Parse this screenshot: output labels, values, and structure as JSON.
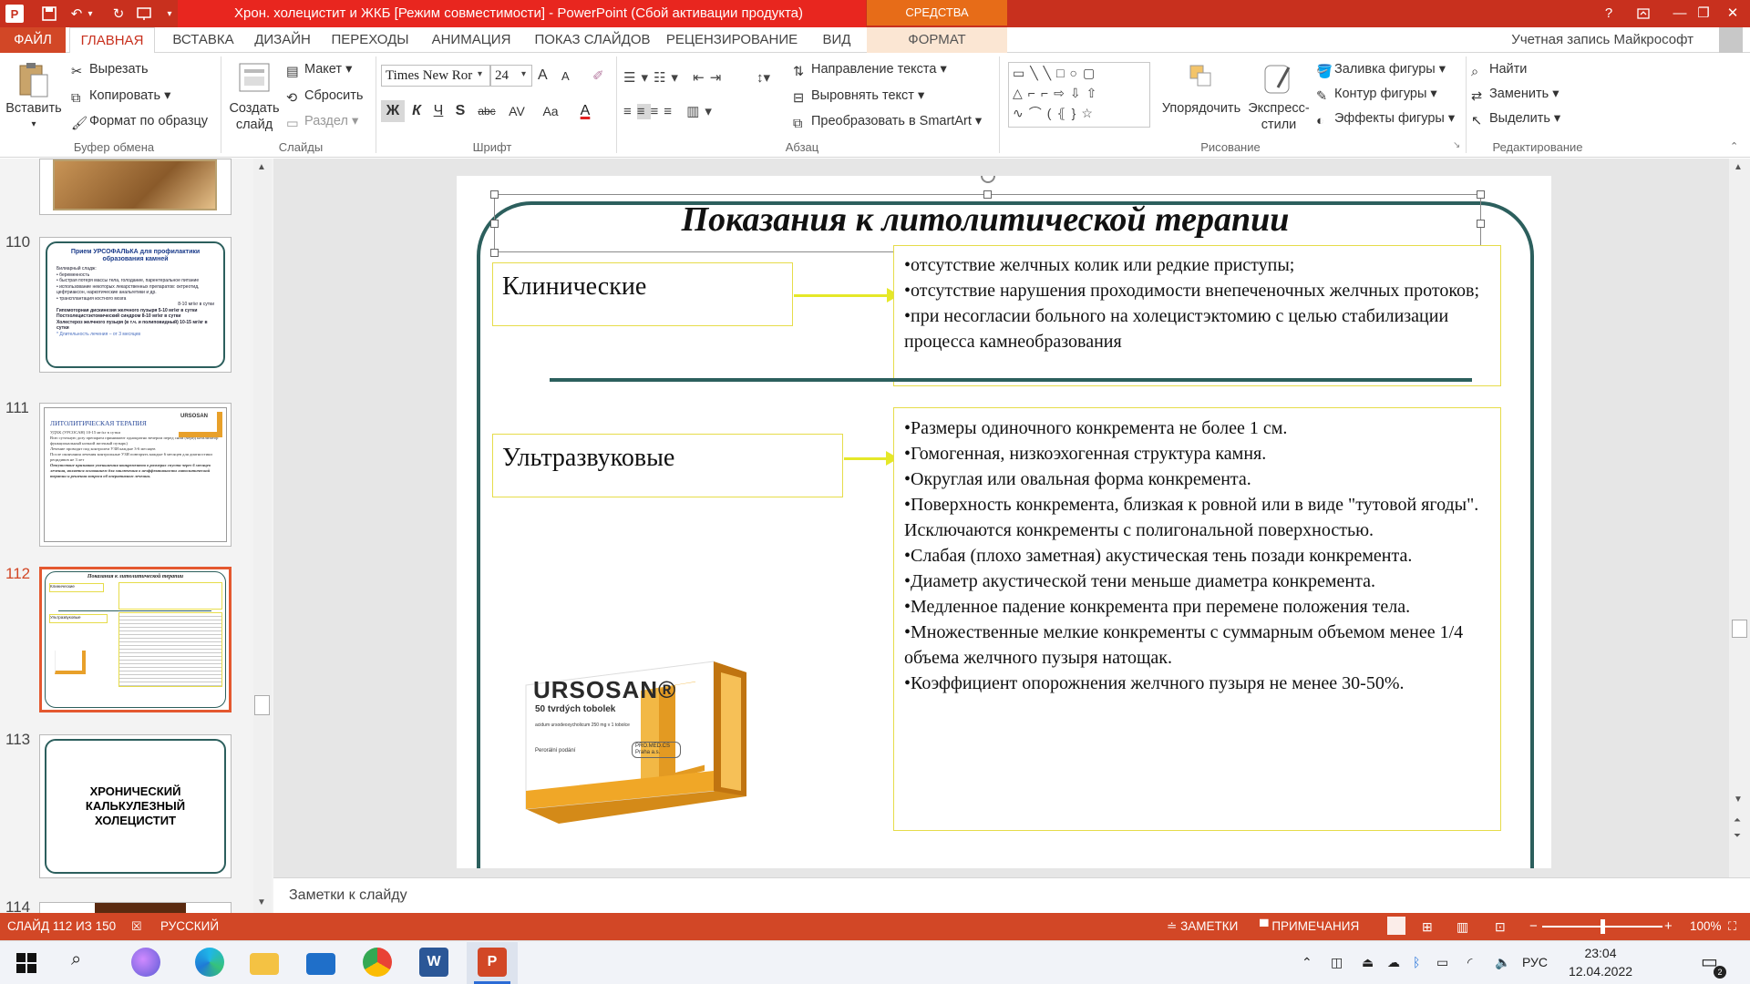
{
  "window": {
    "title": "Хрон. холецистит и ЖКБ [Режим совместимости] - PowerPoint (Сбой активации продукта)",
    "context_group": "СРЕДСТВА РИСОВАНИЯ",
    "help": "?",
    "minimize": "—",
    "restore": "❐",
    "close": "✕"
  },
  "tabs": [
    "ФАЙЛ",
    "ГЛАВНАЯ",
    "ВСТАВКА",
    "ДИЗАЙН",
    "ПЕРЕХОДЫ",
    "АНИМАЦИЯ",
    "ПОКАЗ СЛАЙДОВ",
    "РЕЦЕНЗИРОВАНИЕ",
    "ВИД",
    "ФОРМАТ"
  ],
  "account": "Учетная запись Майкрософт",
  "ribbon": {
    "clipboard": {
      "paste": "Вставить",
      "cut": "Вырезать",
      "copy": "Копировать",
      "format_painter": "Формат по образцу",
      "label": "Буфер обмена"
    },
    "slides": {
      "new_slide": "Создать слайд",
      "layout": "Макет",
      "reset": "Сбросить",
      "section": "Раздел",
      "label": "Слайды"
    },
    "font": {
      "name": "Times New Ror",
      "size": "24",
      "bold": "Ж",
      "italic": "К",
      "underline": "Ч",
      "shadow": "S",
      "strike": "abc",
      "spacing": "AV",
      "case": "Aa",
      "color": "A",
      "grow": "A",
      "shrink": "A",
      "label": "Шрифт"
    },
    "paragraph": {
      "text_direction": "Направление текста",
      "align_text": "Выровнять текст",
      "smartart": "Преобразовать в SmartArt",
      "label": "Абзац"
    },
    "drawing": {
      "shapes_row1": "▭╲╲□○▢",
      "shapes_row2": "△⌐⌐⇨⇩⇧",
      "shapes_row3": "∿⌒(⦃}☆",
      "arrange": "Упорядочить",
      "quick_styles": "Экспресс-стили",
      "fill": "Заливка фигуры",
      "outline": "Контур фигуры",
      "effects": "Эффекты фигуры",
      "label": "Рисование"
    },
    "editing": {
      "find": "Найти",
      "replace": "Заменить",
      "select": "Выделить",
      "label": "Редактирование"
    }
  },
  "thumbnails": [
    {
      "num": "110",
      "title": "Прием УРСОФАЛЬКА для профилактики образования камней",
      "lines": [
        "Билиарный сладж:",
        "• беременность",
        "• быстрая потеря массы тела, голодание, парентеральное питание",
        "• использование некоторых лекарственных препаратов: октреотид, цефтриаксон, наркотические анальгетики и др.",
        "• трансплантация костного мозга",
        "8-10 мг/кг в сутки",
        "Гипомоторная дискинезия желчного пузыря 5-10 мг/кг в сутки",
        "Постхолецистэктомический синдром 8-10 мг/кг в сутки",
        "Холестероз желчного пузыря (в т.ч. и полиповидный) 10-15 мг/кг в сутки",
        "* Длительность лечения – от 3 месяцев"
      ]
    },
    {
      "num": "111",
      "title": "ЛИТОЛИТИЧЕСКАЯ ТЕРАПИЯ",
      "badge": "URSOSAN",
      "lines": [
        "УДХК (УРСОСАН) 10-15 мг/кг в сутки",
        "Всю суточную дозу препарата принимают однократно вечером перед сном (черед катализатор функциональный ночной желчный пузырь)",
        "Лечение проводят под контролем УЗИ каждые 3-6 месяцев",
        "После окончания лечения контрольные УЗИ повторять каждые 6 месяцев для диагностики рецидивов не 3 лет",
        "Отсутствие признаков уменьшения конкрементов в размерах спустя через 6 месяцев лечения, является основанием для заключения о неэффективности литолитической терапии и решения вопроса об оперативном лечении."
      ]
    },
    {
      "num": "112",
      "title": "Показания к литолитической терапии",
      "lines": [
        "Клинические",
        "Ультразвуковые"
      ]
    },
    {
      "num": "113",
      "title": "ХРОНИЧЕСКИЙ КАЛЬКУЛЕЗНЫЙ ХОЛЕЦИСТИТ"
    },
    {
      "num": "114"
    }
  ],
  "slide": {
    "title": "Показания к литолитической терапии",
    "clinical": {
      "label": "Клинические",
      "items": [
        "•отсутствие желчных колик или редкие приступы;",
        "•отсутствие нарушения проходимости внепеченочных желчных протоков;",
        "•при несогласии больного на холецистэктомию с целью стабилизации процесса камнеобразования"
      ]
    },
    "ultrasound": {
      "label": "Ультразвуковые",
      "items": [
        "•Размеры одиночного конкремента не более 1 см.",
        "•Гомогенная, низкоэхогенная структура камня.",
        "•Округлая или овальная форма конкремента.",
        "•Поверхность конкремента, близкая к ровной или в виде \"тутовой ягоды\". Исключаются конкременты с полигональной поверхностью.",
        "•Слабая (плохо заметная) акустическая тень позади конкремента.",
        "•Диаметр акустической тени меньше диаметра конкремента.",
        "•Медленное падение конкремента при перемене положения тела.",
        "•Множественные мелкие конкременты с суммарным объемом менее 1/4 объема желчного пузыря натощак.",
        "•Коэффициент опорожнения желчного пузыря не менее 30-50%."
      ]
    },
    "package": {
      "brand": "URSOSAN®",
      "count": "50 tvrdých tobolek",
      "substance": "acidum ursodeoxycholicum 250 mg v 1 tobolce",
      "route": "Perorální podání",
      "maker": "PRO.MED.CS Praha a.s."
    }
  },
  "notes_placeholder": "Заметки к слайду",
  "status": {
    "slide": "СЛАЙД 112 ИЗ 150",
    "language": "РУССКИЙ",
    "notes": "ЗАМЕТКИ",
    "comments": "ПРИМЕЧАНИЯ",
    "zoom": "100%",
    "zoom_value": 100
  },
  "taskbar": {
    "language": "РУС",
    "time": "23:04",
    "date": "12.04.2022",
    "notif_count": "2"
  },
  "colors": {
    "accent": "#d24726",
    "title_red": "#e8261f",
    "frame": "#2c5f5d",
    "arrow": "#e5e828",
    "box_border": "#e6dc4a",
    "pkg_orange": "#e8a02a"
  }
}
